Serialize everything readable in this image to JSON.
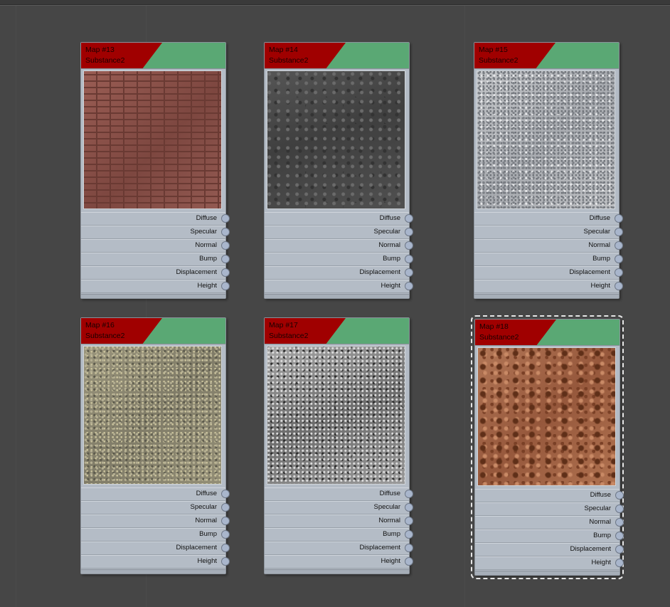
{
  "nodes": [
    {
      "title": "Map #13",
      "subtitle": "Substance2",
      "texture": "brick",
      "selected": false,
      "slots": [
        "Diffuse",
        "Specular",
        "Normal",
        "Bump",
        "Displacement",
        "Height"
      ]
    },
    {
      "title": "Map #14",
      "subtitle": "Substance2",
      "texture": "asphalt",
      "selected": false,
      "slots": [
        "Diffuse",
        "Specular",
        "Normal",
        "Bump",
        "Displacement",
        "Height"
      ]
    },
    {
      "title": "Map #15",
      "subtitle": "Substance2",
      "texture": "granite",
      "selected": false,
      "slots": [
        "Diffuse",
        "Specular",
        "Normal",
        "Bump",
        "Displacement",
        "Height"
      ]
    },
    {
      "title": "Map #16",
      "subtitle": "Substance2",
      "texture": "gravel",
      "selected": false,
      "slots": [
        "Diffuse",
        "Specular",
        "Normal",
        "Bump",
        "Displacement",
        "Height"
      ]
    },
    {
      "title": "Map #17",
      "subtitle": "Substance2",
      "texture": "rock",
      "selected": false,
      "slots": [
        "Diffuse",
        "Specular",
        "Normal",
        "Bump",
        "Displacement",
        "Height"
      ]
    },
    {
      "title": "Map #18",
      "subtitle": "Substance2",
      "texture": "rust",
      "selected": true,
      "slots": [
        "Diffuse",
        "Specular",
        "Normal",
        "Bump",
        "Displacement",
        "Height"
      ]
    }
  ],
  "colors": {
    "canvas_bg": "#464646",
    "node_body": "#b4bcc6",
    "header_green": "#5aa874",
    "header_red": "#a00000",
    "port": "#a9b6cc"
  }
}
